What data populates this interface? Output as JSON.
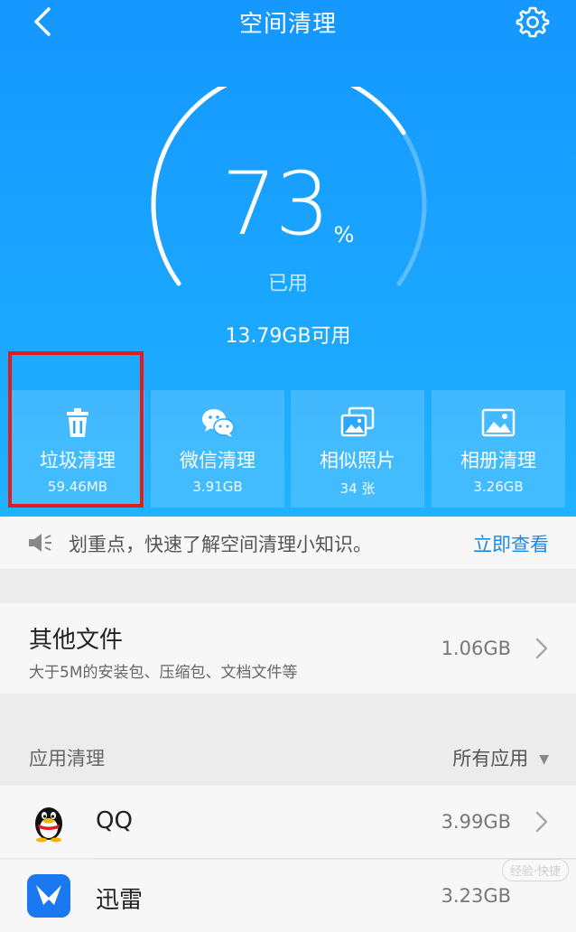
{
  "header": {
    "title": "空间清理",
    "back_icon": "back-arrow-icon",
    "settings_icon": "gear-icon"
  },
  "gauge": {
    "percent": "73",
    "percent_sign": "%",
    "percent_value": 73,
    "used_label": "已用",
    "available_text": "13.79GB可用"
  },
  "tiles": [
    {
      "label": "垃圾清理",
      "sub": "59.46MB",
      "icon": "trash-icon"
    },
    {
      "label": "微信清理",
      "sub": "3.91GB",
      "icon": "wechat-icon"
    },
    {
      "label": "相似照片",
      "sub": "34 张",
      "icon": "similar-photos-icon"
    },
    {
      "label": "相册清理",
      "sub": "3.26GB",
      "icon": "album-icon"
    }
  ],
  "notice": {
    "text": "划重点，快速了解空间清理小知识。",
    "link": "立即查看"
  },
  "other_files": {
    "title": "其他文件",
    "subtitle": "大于5M的安装包、压缩包、文档文件等",
    "size": "1.06GB"
  },
  "app_section": {
    "title": "应用清理",
    "filter": "所有应用"
  },
  "apps": [
    {
      "name": "QQ",
      "size": "3.99GB",
      "icon": "qq-penguin-icon"
    },
    {
      "name": "迅雷",
      "size": "3.23GB",
      "icon": "xunlei-icon"
    }
  ],
  "watermark": "经验·快捷",
  "colors": {
    "hero": "#1aa5ff",
    "accent_link": "#1e88e5",
    "highlight": "#e21c1c"
  }
}
